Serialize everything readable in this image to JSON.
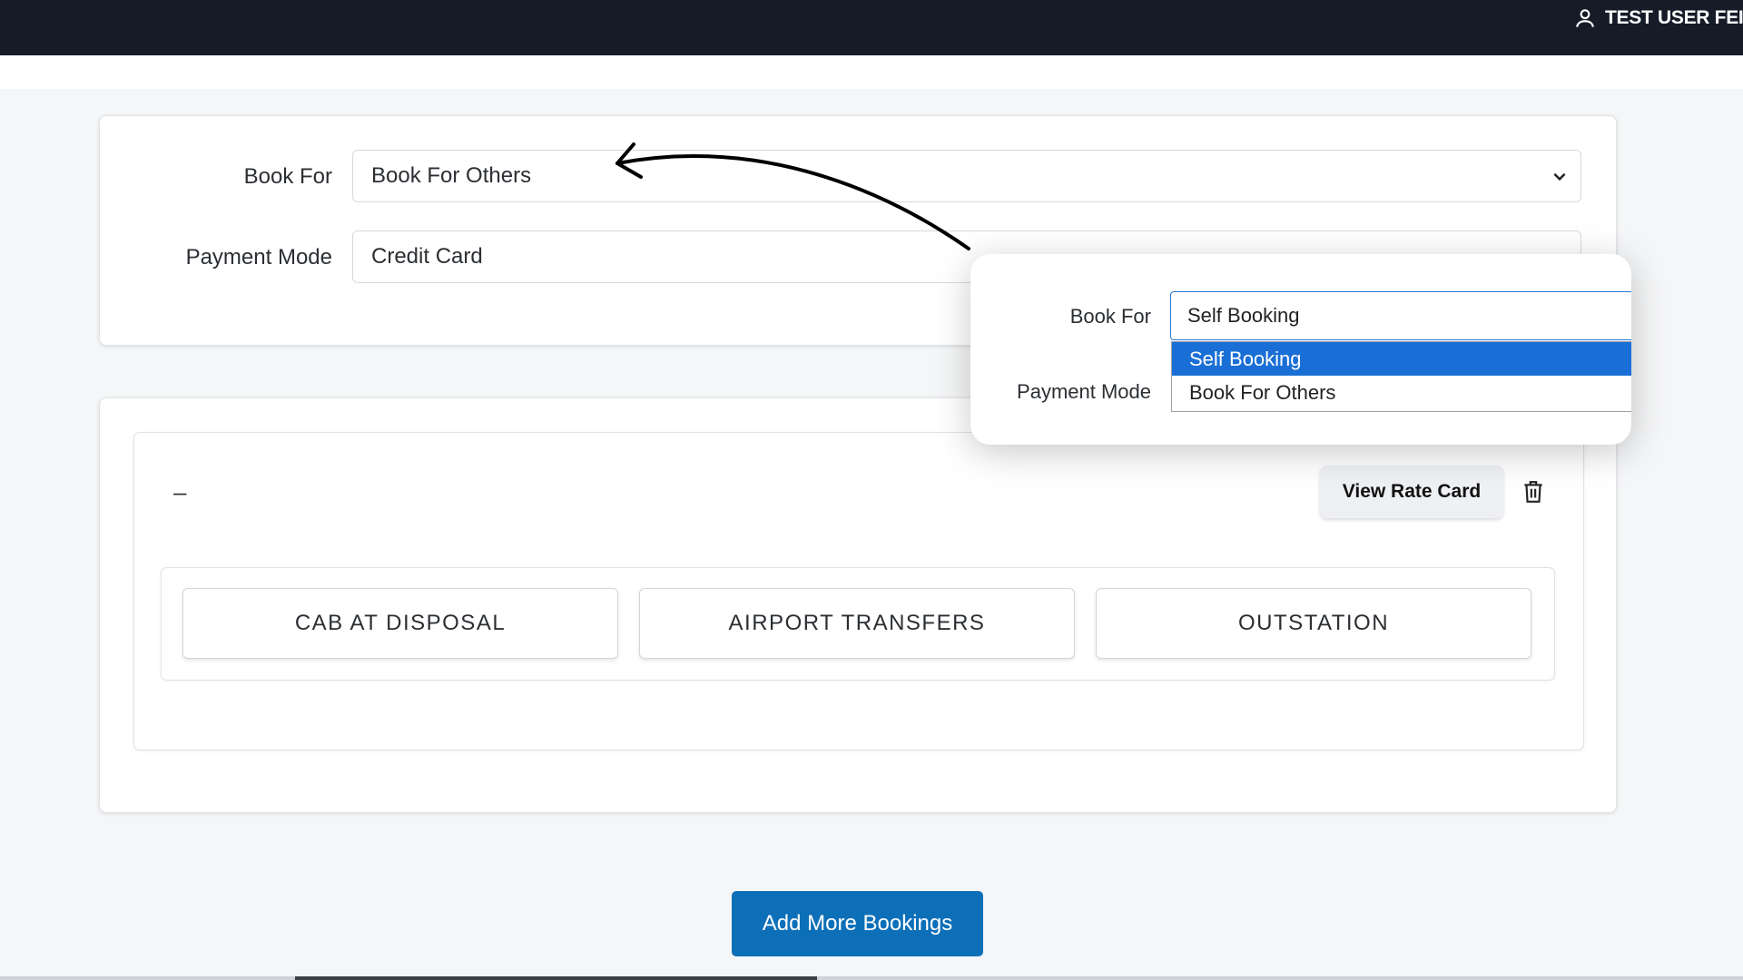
{
  "header": {
    "user_name": "TEST USER FEI",
    "user_icon": "user-icon"
  },
  "booking_form": {
    "book_for_label": "Book For",
    "book_for_value": "Book For Others",
    "payment_mode_label": "Payment Mode",
    "payment_mode_value": "Credit Card"
  },
  "booking_card": {
    "dash": "–",
    "view_rate_card": "View Rate Card",
    "delete_icon": "trash-icon",
    "services": [
      "CAB AT DISPOSAL",
      "AIRPORT TRANSFERS",
      "OUTSTATION"
    ]
  },
  "add_more_label": "Add More Bookings",
  "callout": {
    "book_for_label": "Book For",
    "payment_mode_label": "Payment Mode",
    "selected_value": "Self Booking",
    "options": [
      "Self Booking",
      "Book For Others"
    ],
    "highlighted_index": 0
  },
  "colors": {
    "header_bg": "#151c28",
    "primary": "#0d6fb8",
    "dropdown_highlight": "#1a6fd6"
  }
}
